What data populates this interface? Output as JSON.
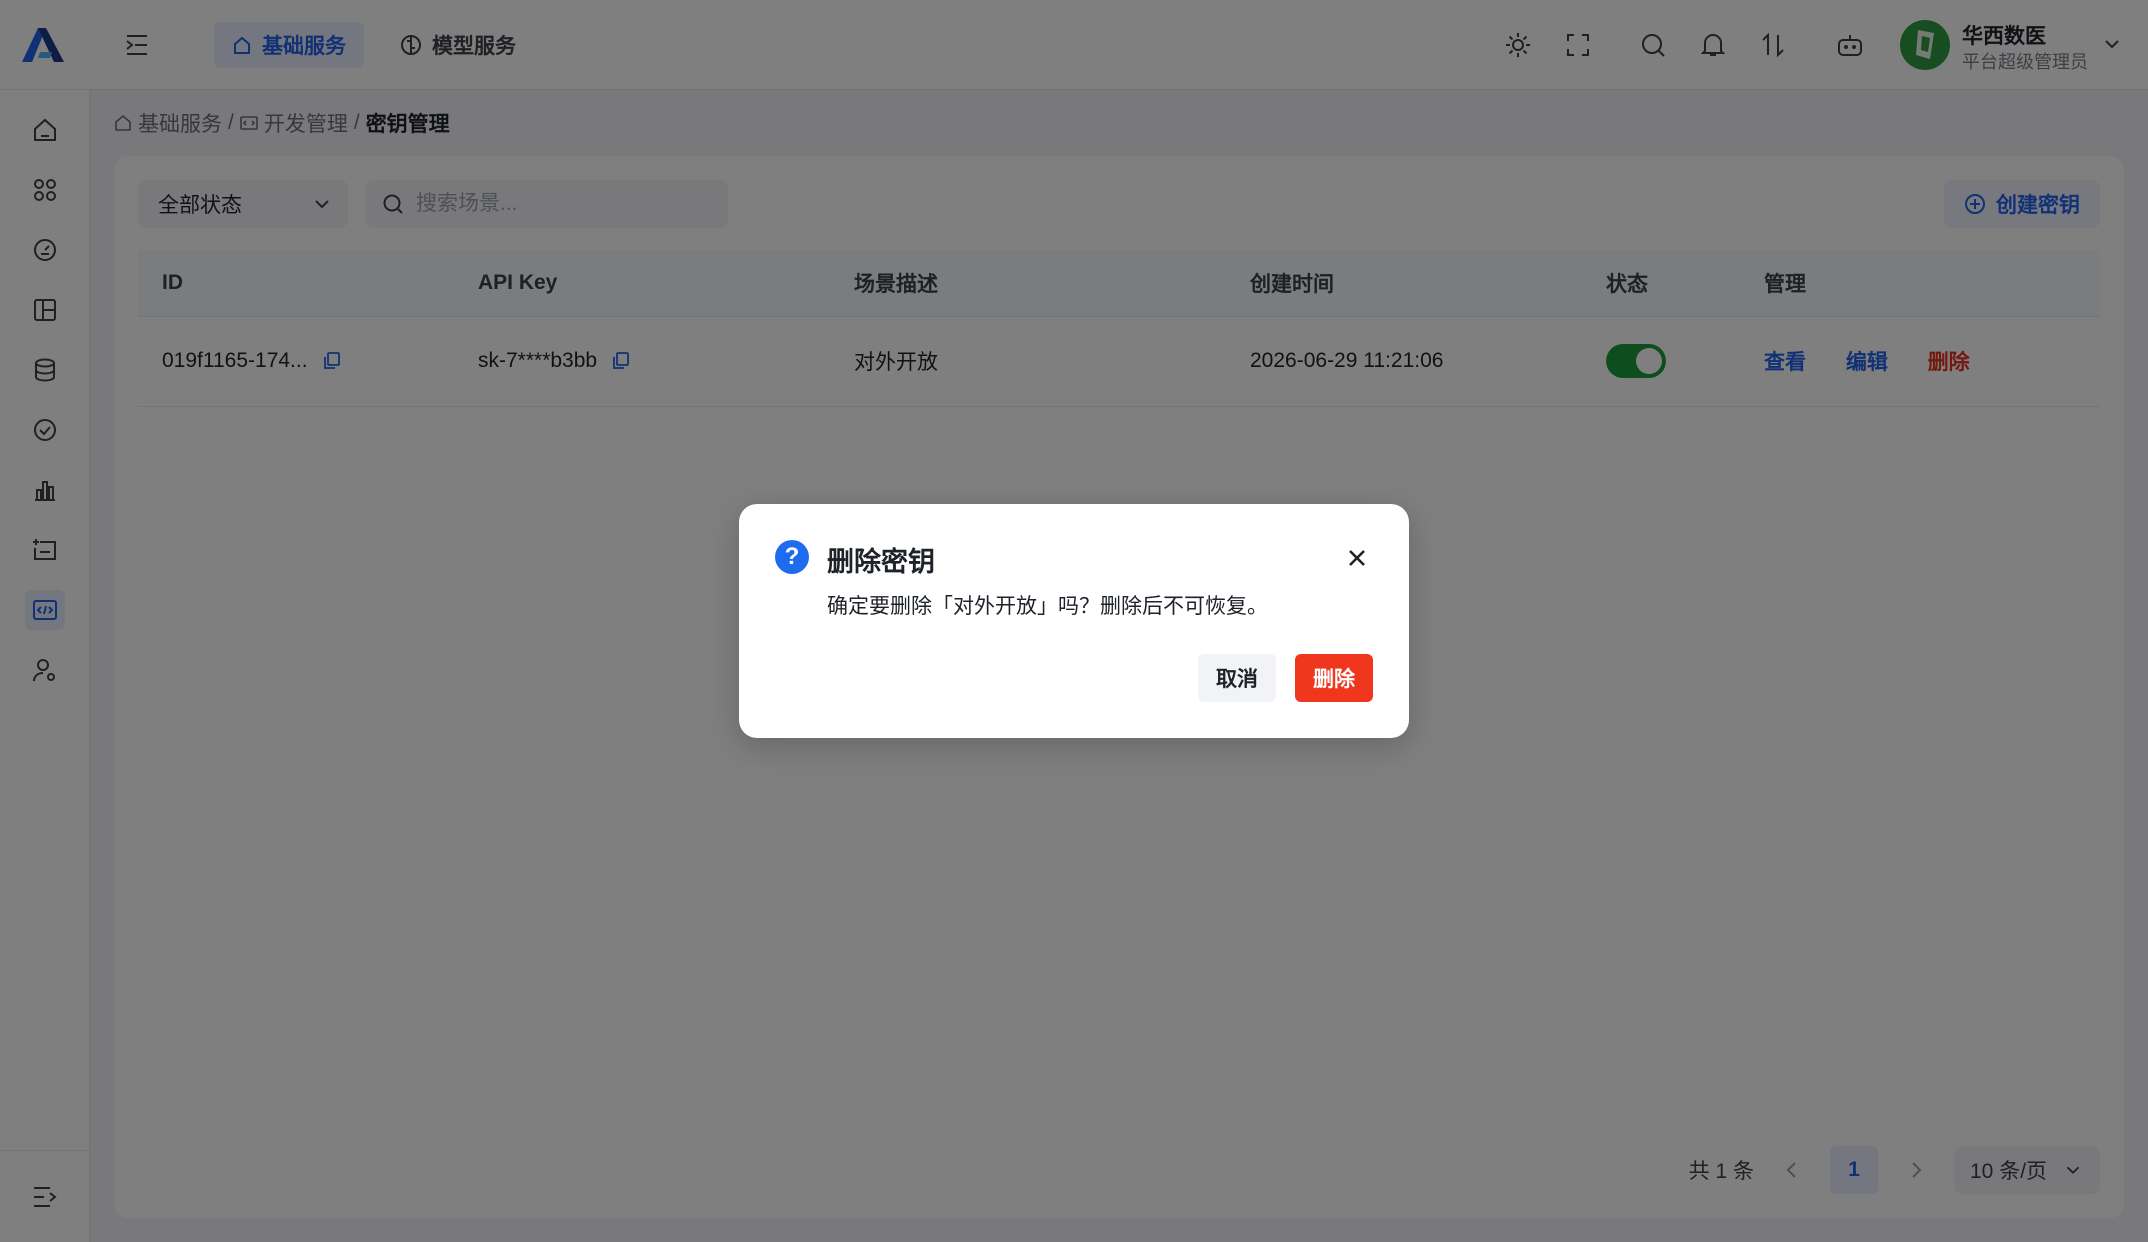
{
  "header": {
    "tabs": [
      {
        "label": "基础服务",
        "icon": "home-icon",
        "active": true
      },
      {
        "label": "模型服务",
        "icon": "brain-icon",
        "active": false
      }
    ],
    "user": {
      "name": "华西数医",
      "role": "平台超级管理员"
    }
  },
  "breadcrumb": {
    "items": [
      "基础服务",
      "开发管理",
      "密钥管理"
    ]
  },
  "toolbar": {
    "status_filter": "全部状态",
    "search_placeholder": "搜索场景...",
    "create_label": "创建密钥"
  },
  "table": {
    "columns": [
      "ID",
      "API Key",
      "场景描述",
      "创建时间",
      "状态",
      "管理"
    ],
    "rows": [
      {
        "id": "019f1165-174...",
        "api_key": "sk-7****b3bb",
        "description": "对外开放",
        "created_at": "2026-06-29 11:21:06",
        "enabled": true,
        "actions": {
          "view": "查看",
          "edit": "编辑",
          "delete": "删除"
        }
      }
    ]
  },
  "pagination": {
    "total_label": "共 1 条",
    "current_page": "1",
    "page_size": "10 条/页"
  },
  "modal": {
    "title": "删除密钥",
    "message": "确定要删除「对外开放」吗？删除后不可恢复。",
    "cancel_label": "取消",
    "confirm_label": "删除"
  },
  "colors": {
    "primary": "#2463eb",
    "danger": "#f0361c",
    "success": "#1d9a3d"
  }
}
